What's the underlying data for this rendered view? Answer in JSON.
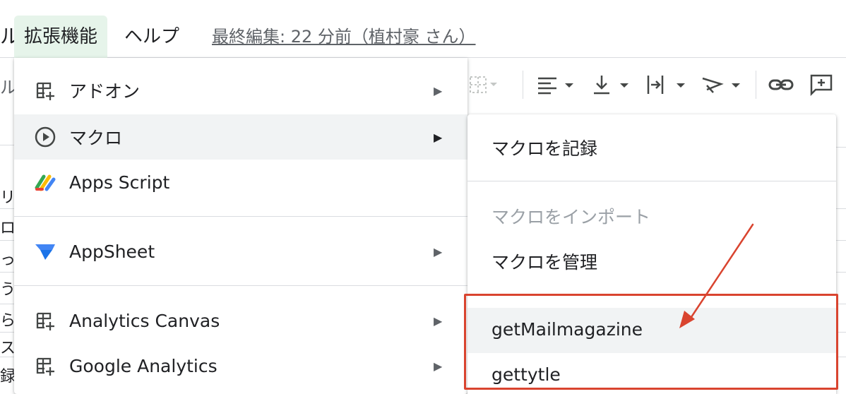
{
  "menubar": {
    "cut_label": "ル",
    "items": [
      {
        "label": "拡張機能"
      },
      {
        "label": "ヘルプ"
      }
    ],
    "last_edit": "最終編集: 22 分前（植村豪 さん）"
  },
  "toolbar": {
    "cut_label": "ル",
    "icons": [
      "borders-icon",
      "align-left-icon",
      "valign-bottom-icon",
      "text-wrap-icon",
      "text-rotate-icon",
      "link-icon",
      "comment-add-icon"
    ]
  },
  "sheet_fragments": [
    "リカ",
    "ロ",
    "っ",
    "う",
    "ら",
    "ス",
    "録フ"
  ],
  "extensions_menu": {
    "items": [
      {
        "label": "アドオン",
        "icon": "addon-icon",
        "has_submenu": true
      },
      {
        "label": "マクロ",
        "icon": "play-circle-icon",
        "has_submenu": true,
        "highlighted": true
      },
      {
        "label": "Apps Script",
        "icon": "apps-script-icon",
        "has_submenu": false
      },
      {
        "label": "AppSheet",
        "icon": "appsheet-icon",
        "has_submenu": true
      },
      {
        "label": "Analytics Canvas",
        "icon": "addon-icon",
        "has_submenu": true
      },
      {
        "label": "Google Analytics",
        "icon": "addon-icon",
        "has_submenu": true
      }
    ]
  },
  "macro_submenu": {
    "items": [
      {
        "label": "マクロを記録",
        "disabled": false
      },
      {
        "label": "マクロをインポート",
        "disabled": true
      },
      {
        "label": "マクロを管理",
        "disabled": false
      },
      {
        "label": "getMailmagazine",
        "disabled": false,
        "highlighted": true
      },
      {
        "label": "gettytle",
        "disabled": false
      }
    ]
  },
  "colors": {
    "active_menu_bg": "#e6f4ea",
    "hover_bg": "#f1f3f4",
    "annotation": "#d9442f",
    "disabled_text": "#9aa0a6"
  }
}
